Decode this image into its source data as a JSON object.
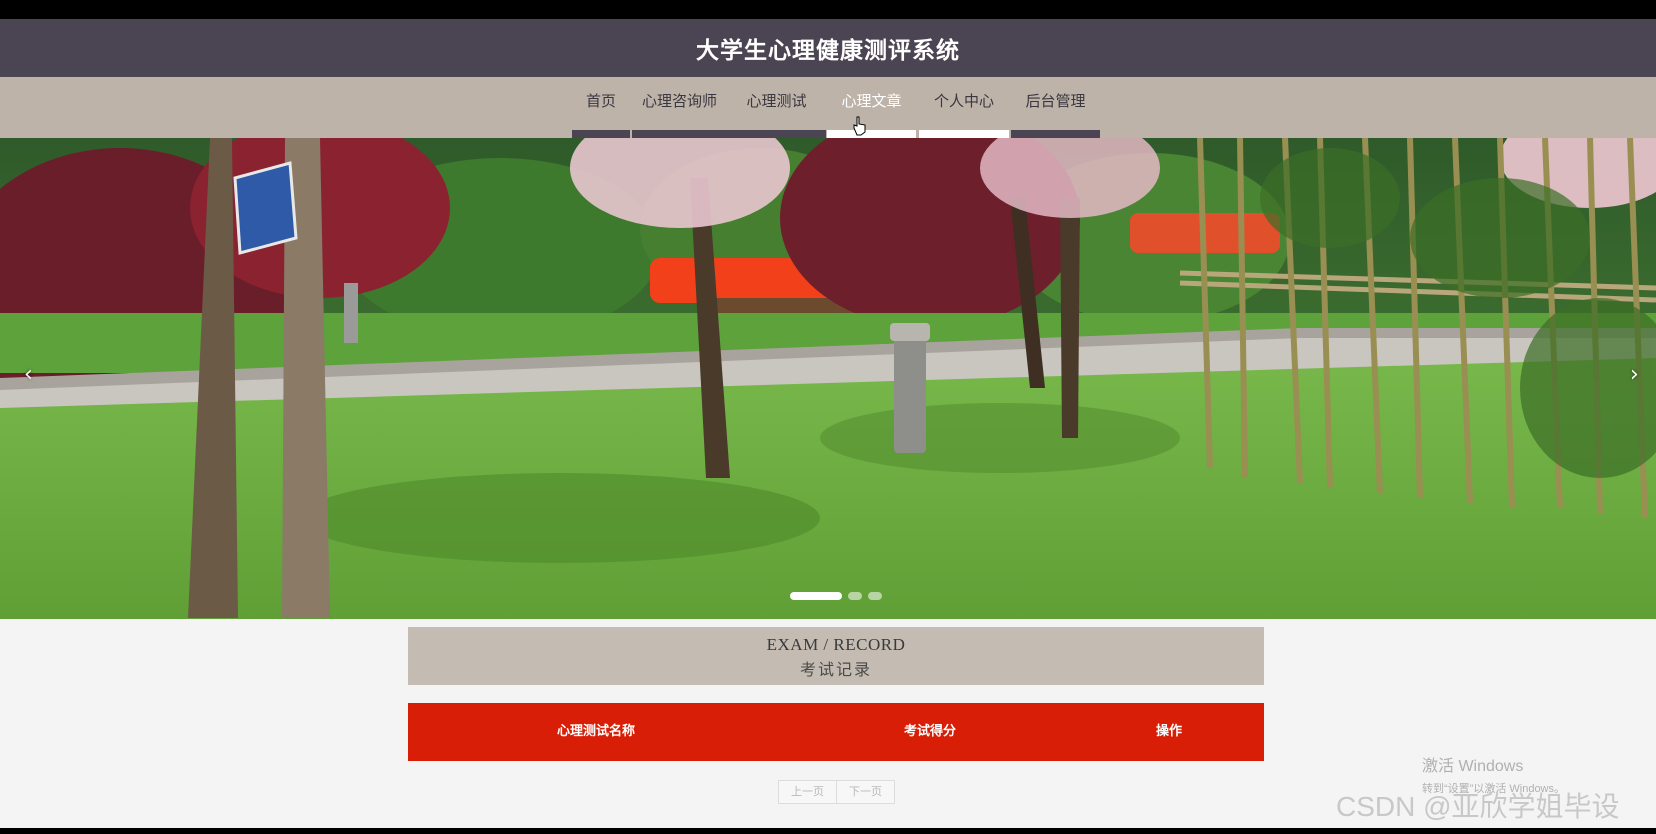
{
  "header": {
    "title": "大学生心理健康测评系统"
  },
  "nav": {
    "items": [
      {
        "label": "首页"
      },
      {
        "label": "心理咨询师"
      },
      {
        "label": "心理测试"
      },
      {
        "label": "心理文章"
      },
      {
        "label": "个人中心"
      },
      {
        "label": "后台管理"
      }
    ],
    "active": "心理文章"
  },
  "banner": {
    "prev_glyph": "‹",
    "next_glyph": "›",
    "slide_count": 3,
    "active_slide": 1
  },
  "section": {
    "title_en": "EXAM / RECORD",
    "title_zh": "考试记录"
  },
  "table": {
    "columns": [
      "心理测试名称",
      "考试得分",
      "操作"
    ],
    "header_color": "#d81e06",
    "rows": []
  },
  "pager": {
    "prev": "上一页",
    "next": "下一页"
  },
  "overlay": {
    "windows_line1": "激活 Windows",
    "windows_line2": "转到“设置”以激活 Windows。",
    "csdn": "CSDN @亚欣学姐毕设"
  },
  "colors": {
    "titlebar": "#4b4453",
    "navbar": "#bdb3a9",
    "section": "#c4bcb3"
  }
}
